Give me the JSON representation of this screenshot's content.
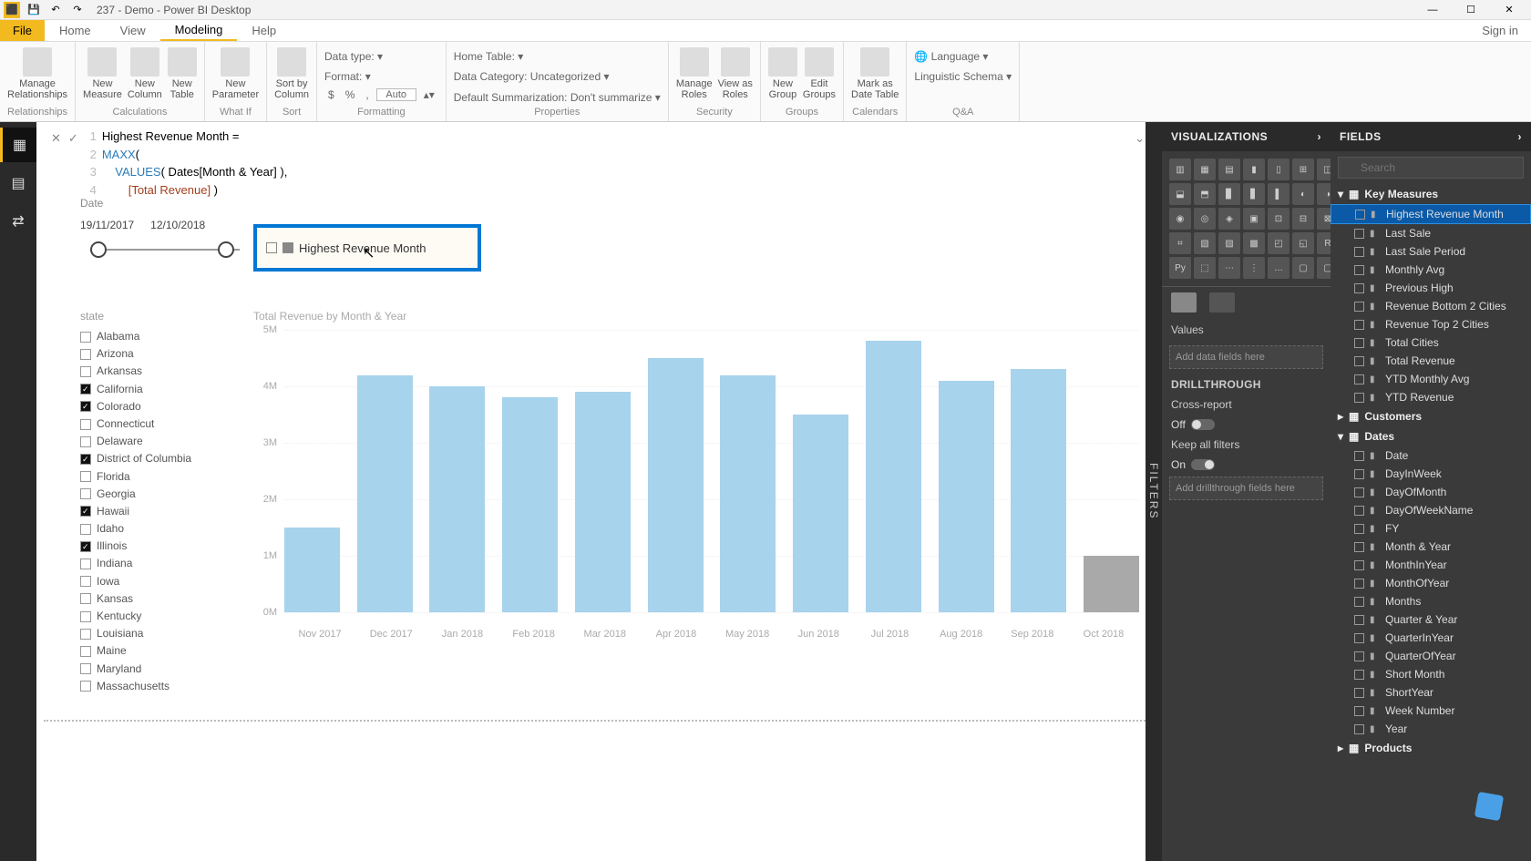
{
  "app": {
    "title": "237 - Demo - Power BI Desktop",
    "signin": "Sign in"
  },
  "menu": {
    "file": "File",
    "tabs": [
      "Home",
      "View",
      "Modeling",
      "Help"
    ],
    "active": "Modeling"
  },
  "ribbon": {
    "relationships": {
      "btn": "Manage\nRelationships",
      "group": "Relationships"
    },
    "calculations": {
      "btns": [
        "New\nMeasure",
        "New\nColumn",
        "New\nTable",
        "New\nParameter"
      ],
      "group": "Calculations"
    },
    "whatif": {
      "group": "What If"
    },
    "sort": {
      "btn": "Sort by\nColumn",
      "group": "Sort"
    },
    "formatting": {
      "datatype": "Data type:",
      "format": "Format:",
      "symbols": [
        "$",
        "%",
        ","
      ],
      "auto": "Auto",
      "group": "Formatting"
    },
    "properties": {
      "hometable": "Home Table:",
      "datacat": "Data Category: Uncategorized",
      "summ": "Default Summarization: Don't summarize",
      "group": "Properties"
    },
    "security": {
      "btns": [
        "Manage\nRoles",
        "View as\nRoles"
      ],
      "group": "Security"
    },
    "groups": {
      "btns": [
        "New\nGroup",
        "Edit\nGroups"
      ],
      "group": "Groups"
    },
    "calendars": {
      "btn": "Mark as\nDate Table",
      "group": "Calendars"
    },
    "qa": {
      "lang": "Language",
      "schema": "Linguistic Schema",
      "group": "Q&A"
    }
  },
  "formula": {
    "lines": [
      {
        "n": "1",
        "plain": "Highest Revenue Month ="
      },
      {
        "n": "2",
        "fn": "MAXX",
        "rest": "("
      },
      {
        "n": "3",
        "indent": "    ",
        "fn": "VALUES",
        "rest": "( Dates[Month & Year] ),"
      },
      {
        "n": "4",
        "indent": "        ",
        "meas": "[Total Revenue]",
        "rest": " )"
      }
    ]
  },
  "canvas": {
    "dateLabel": "Date",
    "dateStart": "19/11/2017",
    "dateEnd": "12/10/2018",
    "card": {
      "label": "Highest Revenue Month"
    },
    "slicer": {
      "header": "state",
      "items": [
        {
          "label": "Alabama",
          "checked": false
        },
        {
          "label": "Arizona",
          "checked": false
        },
        {
          "label": "Arkansas",
          "checked": false
        },
        {
          "label": "California",
          "checked": true
        },
        {
          "label": "Colorado",
          "checked": true
        },
        {
          "label": "Connecticut",
          "checked": false
        },
        {
          "label": "Delaware",
          "checked": false
        },
        {
          "label": "District of Columbia",
          "checked": true
        },
        {
          "label": "Florida",
          "checked": false
        },
        {
          "label": "Georgia",
          "checked": false
        },
        {
          "label": "Hawaii",
          "checked": true
        },
        {
          "label": "Idaho",
          "checked": false
        },
        {
          "label": "Illinois",
          "checked": true
        },
        {
          "label": "Indiana",
          "checked": false
        },
        {
          "label": "Iowa",
          "checked": false
        },
        {
          "label": "Kansas",
          "checked": false
        },
        {
          "label": "Kentucky",
          "checked": false
        },
        {
          "label": "Louisiana",
          "checked": false
        },
        {
          "label": "Maine",
          "checked": false
        },
        {
          "label": "Maryland",
          "checked": false
        },
        {
          "label": "Massachusetts",
          "checked": false
        }
      ]
    }
  },
  "chart_data": {
    "type": "bar",
    "title": "Total Revenue by Month & Year",
    "categories": [
      "Nov 2017",
      "Dec 2017",
      "Jan 2018",
      "Feb 2018",
      "Mar 2018",
      "Apr 2018",
      "May 2018",
      "Jun 2018",
      "Jul 2018",
      "Aug 2018",
      "Sep 2018",
      "Oct 2018"
    ],
    "values": [
      1.5,
      4.2,
      4.0,
      3.8,
      3.9,
      4.5,
      4.2,
      3.5,
      4.8,
      4.1,
      4.3,
      1.0
    ],
    "highlight_off": [
      11
    ],
    "ylabel": "",
    "ylim": [
      0,
      5
    ],
    "yticks": [
      "0M",
      "1M",
      "2M",
      "3M",
      "4M",
      "5M"
    ]
  },
  "viz": {
    "header": "VISUALIZATIONS",
    "values": "Values",
    "valuesWell": "Add data fields here",
    "drill": "DRILLTHROUGH",
    "cross": "Cross-report",
    "crossState": "Off",
    "keep": "Keep all filters",
    "keepState": "On",
    "drillWell": "Add drillthrough fields here"
  },
  "filters": {
    "label": "FILTERS"
  },
  "fields": {
    "header": "FIELDS",
    "searchPH": "Search",
    "tables": [
      {
        "name": "Key Measures",
        "expanded": true,
        "fields": [
          {
            "name": "Highest Revenue Month",
            "selected": true
          },
          {
            "name": "Last Sale"
          },
          {
            "name": "Last Sale Period"
          },
          {
            "name": "Monthly Avg"
          },
          {
            "name": "Previous High"
          },
          {
            "name": "Revenue Bottom 2 Cities"
          },
          {
            "name": "Revenue Top 2 Cities"
          },
          {
            "name": "Total Cities"
          },
          {
            "name": "Total Revenue"
          },
          {
            "name": "YTD Monthly Avg"
          },
          {
            "name": "YTD Revenue"
          }
        ]
      },
      {
        "name": "Customers",
        "expanded": false,
        "fields": []
      },
      {
        "name": "Dates",
        "expanded": true,
        "fields": [
          {
            "name": "Date",
            "hier": true
          },
          {
            "name": "DayInWeek"
          },
          {
            "name": "DayOfMonth"
          },
          {
            "name": "DayOfWeekName"
          },
          {
            "name": "FY"
          },
          {
            "name": "Month & Year"
          },
          {
            "name": "MonthInYear"
          },
          {
            "name": "MonthOfYear"
          },
          {
            "name": "Months"
          },
          {
            "name": "Quarter & Year"
          },
          {
            "name": "QuarterInYear"
          },
          {
            "name": "QuarterOfYear"
          },
          {
            "name": "Short Month"
          },
          {
            "name": "ShortYear"
          },
          {
            "name": "Week Number"
          },
          {
            "name": "Year"
          }
        ]
      },
      {
        "name": "Products",
        "expanded": false,
        "fields": []
      }
    ]
  }
}
